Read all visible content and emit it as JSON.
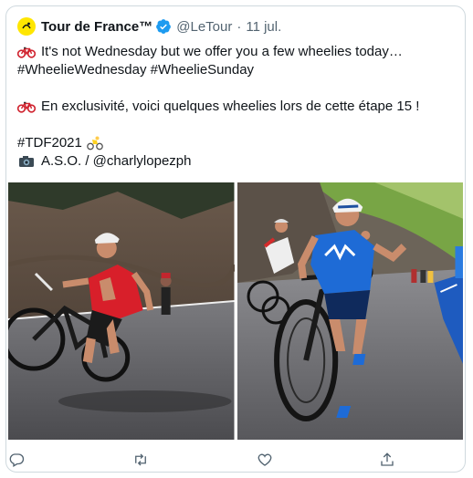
{
  "tweet": {
    "author_name": "Tour de France™",
    "handle": "@LeTour",
    "separator": "·",
    "date": "11 jul.",
    "lines": [
      "It's not Wednesday but we offer you a few wheelies today…",
      "#WheelieWednesday #WheelieSunday",
      "En exclusivité, voici quelques wheelies lors de cette étape 15 !",
      "#TDF2021",
      "A.S.O. / @charlylopezph"
    ]
  },
  "icons": {
    "avatar": "tour-de-france-logo",
    "verified": "verified-badge-icon",
    "emoji_bike": "bicycle-emoji",
    "emoji_cyclist": "yellow-jersey-cyclist-emoji",
    "emoji_camera": "camera-emoji",
    "actions": [
      "reply-icon",
      "retweet-icon",
      "like-icon",
      "share-icon"
    ]
  },
  "colors": {
    "accent": "#1d9bf0",
    "muted": "#536471",
    "border": "#cfd9de",
    "brand_yellow": "#ffe600"
  }
}
